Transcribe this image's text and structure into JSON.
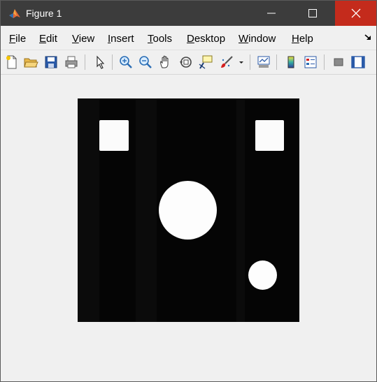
{
  "window": {
    "title": "Figure 1",
    "controls": {
      "minimize": "minimize-icon",
      "maximize": "maximize-icon",
      "close": "close-icon"
    },
    "colors": {
      "titlebar": "#3c3c3c",
      "close": "#c42b1c",
      "background": "#f0f0f0"
    }
  },
  "menu": {
    "items": [
      {
        "first": "F",
        "rest": "ile"
      },
      {
        "first": "E",
        "rest": "dit"
      },
      {
        "first": "V",
        "rest": "iew"
      },
      {
        "first": "I",
        "rest": "nsert"
      },
      {
        "first": "T",
        "rest": "ools"
      },
      {
        "first": "D",
        "rest": "esktop"
      },
      {
        "first": "W",
        "rest": "indow"
      },
      {
        "first": "H",
        "rest": "elp"
      }
    ]
  },
  "toolbar": {
    "icons": [
      "new-figure-icon",
      "open-file-icon",
      "save-icon",
      "print-icon",
      "select-arrow-icon",
      "zoom-in-icon",
      "zoom-out-icon",
      "pan-hand-icon",
      "rotate-3d-icon",
      "data-cursor-icon",
      "brush-icon",
      "brush-dropdown-icon",
      "link-plot-icon",
      "colorbar-icon",
      "legend-icon",
      "hide-plot-tools-icon",
      "show-plot-tools-icon"
    ]
  },
  "figure": {
    "content": "binary image: black background with two white squares, a large white circle and a small white circle",
    "colors": {
      "background": "#050505",
      "shapes": "#fbfbfb"
    }
  }
}
